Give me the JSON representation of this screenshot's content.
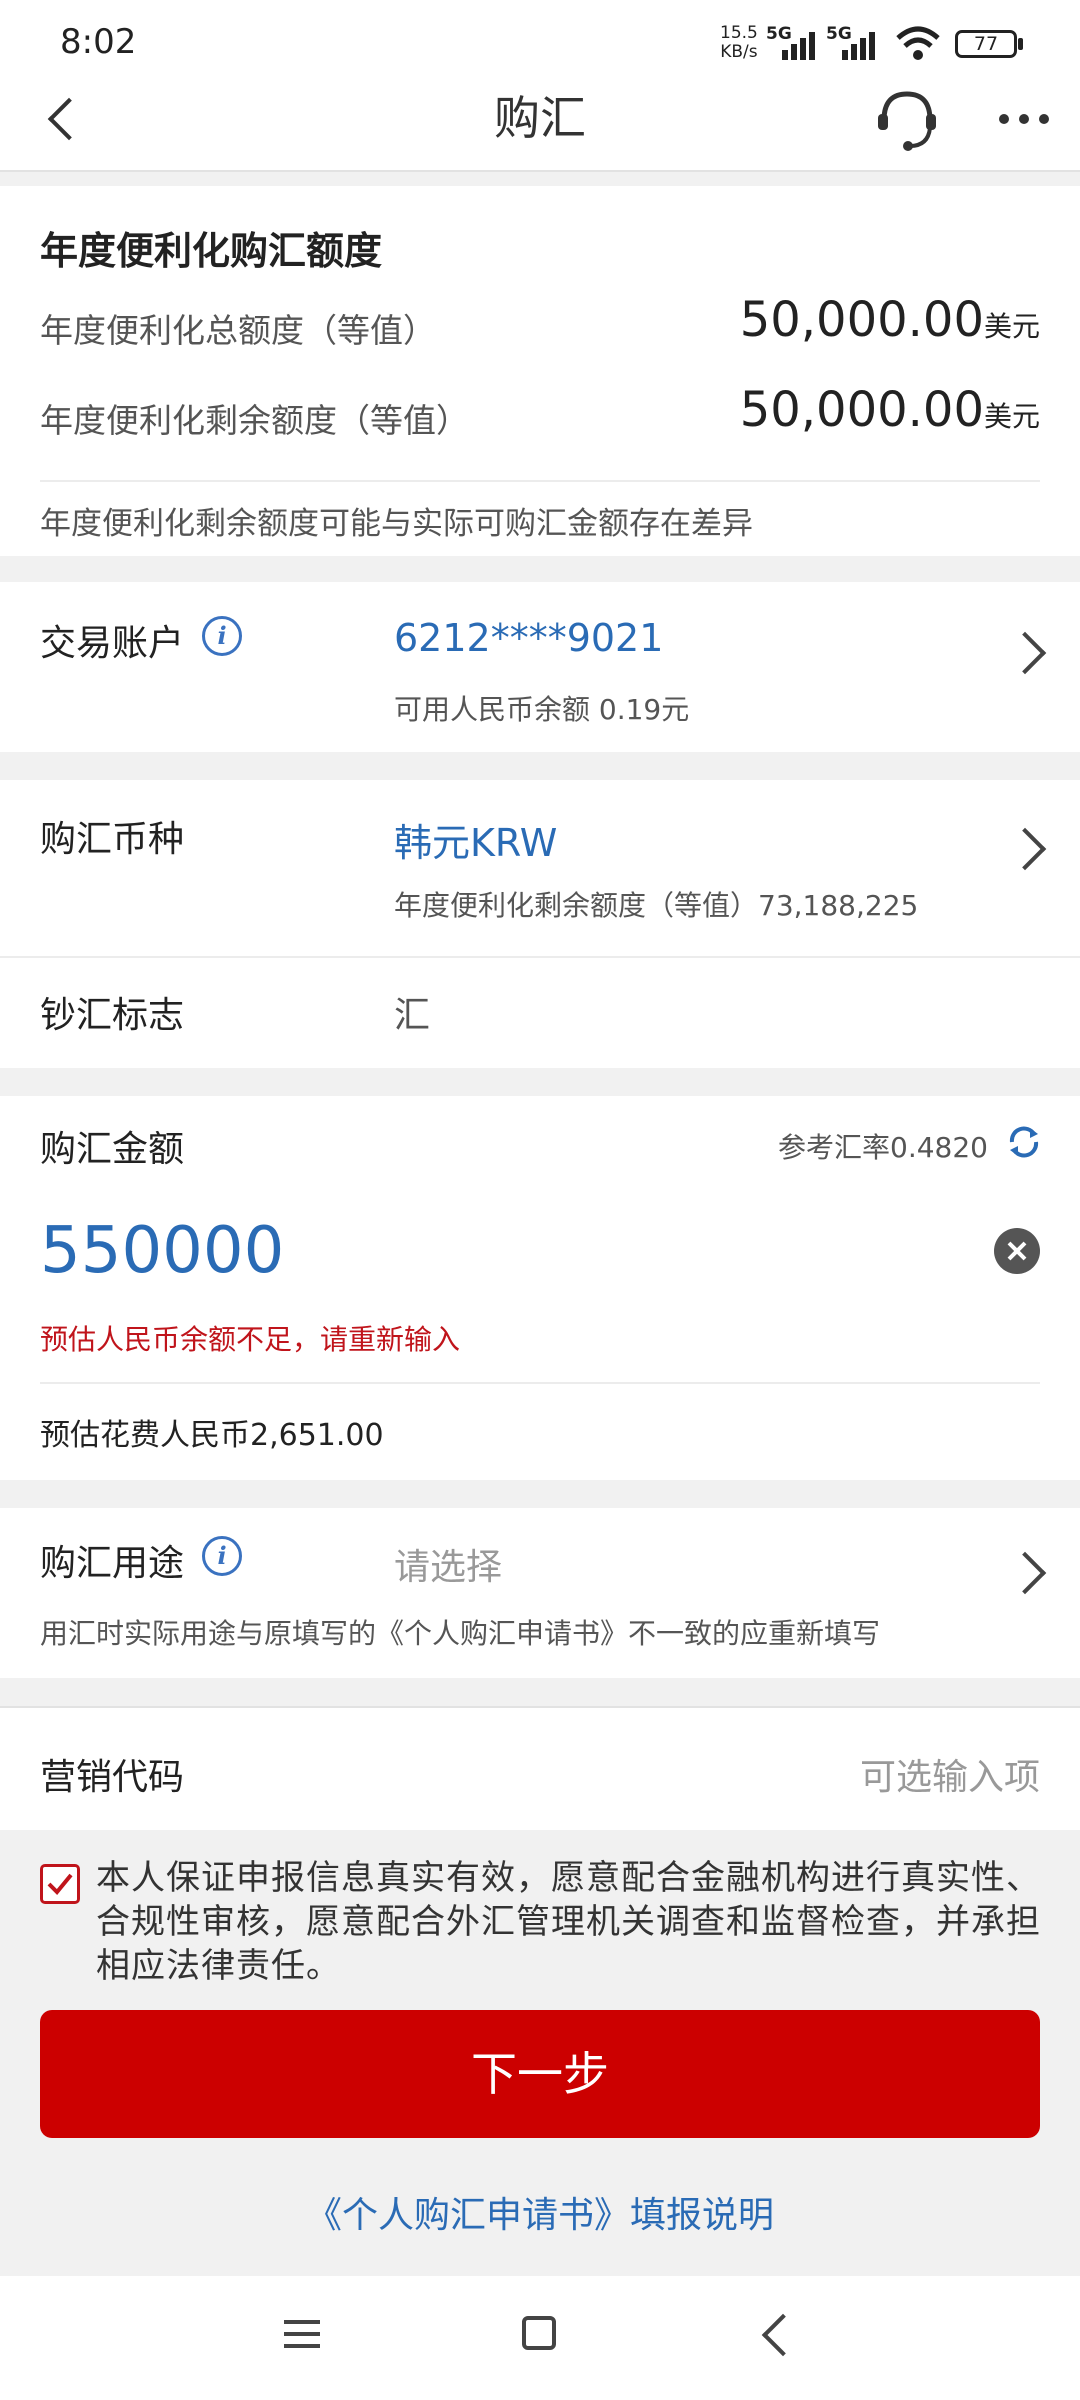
{
  "status_bar": {
    "time": "8:02",
    "net_speed_top": "15.5",
    "net_speed_bottom": "KB/s",
    "sig1": "5G",
    "sig2": "5G",
    "battery": "77"
  },
  "header": {
    "title": "购汇"
  },
  "quota": {
    "title": "年度便利化购汇额度",
    "total_label": "年度便利化总额度（等值）",
    "total_value": "50,000.00",
    "total_unit": "美元",
    "remaining_label": "年度便利化剩余额度（等值）",
    "remaining_value": "50,000.00",
    "remaining_unit": "美元",
    "note": "年度便利化剩余额度可能与实际可购汇金额存在差异"
  },
  "account": {
    "label": "交易账户",
    "number": "6212****9021",
    "balance": "可用人民币余额 0.19元"
  },
  "currency": {
    "label": "购汇币种",
    "value": "韩元KRW",
    "sub": "年度便利化剩余额度（等值）73,188,225"
  },
  "cash_flag": {
    "label": "钞汇标志",
    "value": "汇"
  },
  "amount": {
    "label": "购汇金额",
    "rate": "参考汇率0.4820",
    "value": "550000",
    "error": "预估人民币余额不足，请重新输入",
    "estimate": "预估花费人民币2,651.00"
  },
  "purpose": {
    "label": "购汇用途",
    "placeholder": "请选择",
    "note": "用汇时实际用途与原填写的《个人购汇申请书》不一致的应重新填写"
  },
  "marketing": {
    "label": "营销代码",
    "placeholder": "可选输入项"
  },
  "agreement": {
    "checked": true,
    "text": "本人保证申报信息真实有效，愿意配合金融机构进行真实性、合规性审核，愿意配合外汇管理机关调查和监督检查，并承担相应法律责任。"
  },
  "next_button": "下一步",
  "instructions_link": "《个人购汇申请书》填报说明",
  "colors": {
    "accent": "#cc0000",
    "link": "#2a6bb5",
    "error": "#c0141b"
  }
}
